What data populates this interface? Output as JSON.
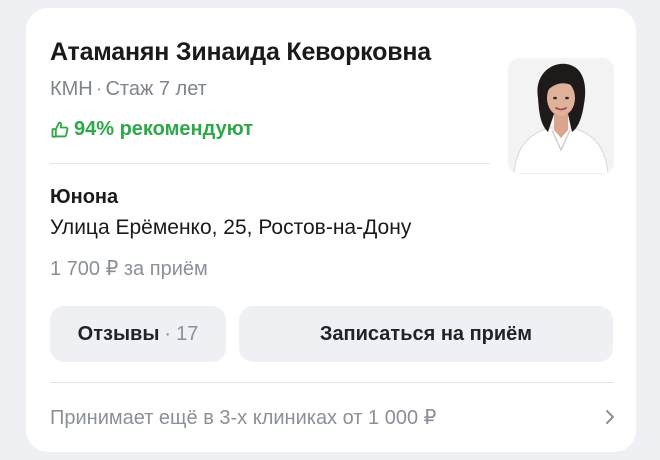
{
  "doctor": {
    "name": "Атаманян Зинаида Кеворковна",
    "degree": "КМН",
    "meta_separator": "·",
    "experience": "Стаж 7 лет",
    "recommend": "94% рекомендуют",
    "photo_icon": "doctor-photo"
  },
  "clinic": {
    "name": "Юнона",
    "address": "Улица Ерёменко, 25, Ростов-на-Дону",
    "price": "1 700 ₽ за приём"
  },
  "actions": {
    "reviews_label": "Отзывы",
    "reviews_separator": "·",
    "reviews_count": "17",
    "book_label": "Записаться на приём"
  },
  "other_clinics": {
    "text": "Принимает ещё в 3-х клиниках от 1 000 ₽",
    "icon": "chevron-right-icon"
  },
  "colors": {
    "accent_green": "#2ea84a",
    "muted_text": "#8a9097",
    "button_bg": "#eef0f3"
  }
}
